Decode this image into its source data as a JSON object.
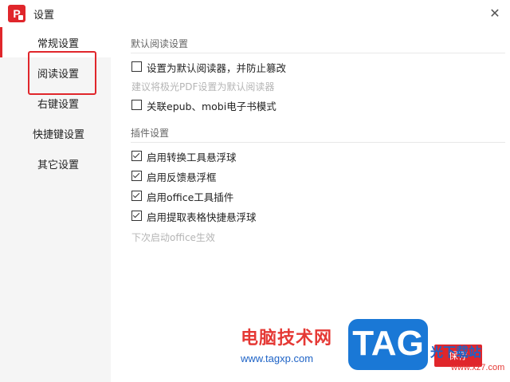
{
  "window": {
    "title": "设置",
    "logo_letter": "P",
    "close_glyph": "✕"
  },
  "sidebar": {
    "items": [
      {
        "label": "常规设置",
        "active": true
      },
      {
        "label": "阅读设置",
        "active": false
      },
      {
        "label": "右键设置",
        "active": false
      },
      {
        "label": "快捷键设置",
        "active": false
      },
      {
        "label": "其它设置",
        "active": false
      }
    ]
  },
  "main": {
    "reading_section": {
      "title": "默认阅读设置",
      "options": [
        {
          "label": "设置为默认阅读器，并防止篡改",
          "checked": false
        },
        {
          "label": "关联epub、mobi电子书模式",
          "checked": false
        }
      ],
      "hint": "建议将极光PDF设置为默认阅读器"
    },
    "plugin_section": {
      "title": "插件设置",
      "options": [
        {
          "label": "启用转换工具悬浮球",
          "checked": true
        },
        {
          "label": "启用反馈悬浮框",
          "checked": true
        },
        {
          "label": "启用office工具插件",
          "checked": true
        },
        {
          "label": "启用提取表格快捷悬浮球",
          "checked": true
        }
      ],
      "hint": "下次启动office生效"
    }
  },
  "footer": {
    "save_label": "保存"
  },
  "watermark": {
    "brand_cn": "电脑技术网",
    "url": "www.tagxp.com",
    "tag": "TAG",
    "site_cn": "光下载站",
    "site_url": "www.xz7.com"
  },
  "colors": {
    "accent": "#e0262b",
    "sidebar_bg": "#f5f5f5",
    "hint_text": "#b5b5b5",
    "watermark_blue": "#1a78d6"
  },
  "icons": {
    "app": "app-logo-icon",
    "close": "close-icon",
    "checkbox": "checkbox-icon"
  }
}
